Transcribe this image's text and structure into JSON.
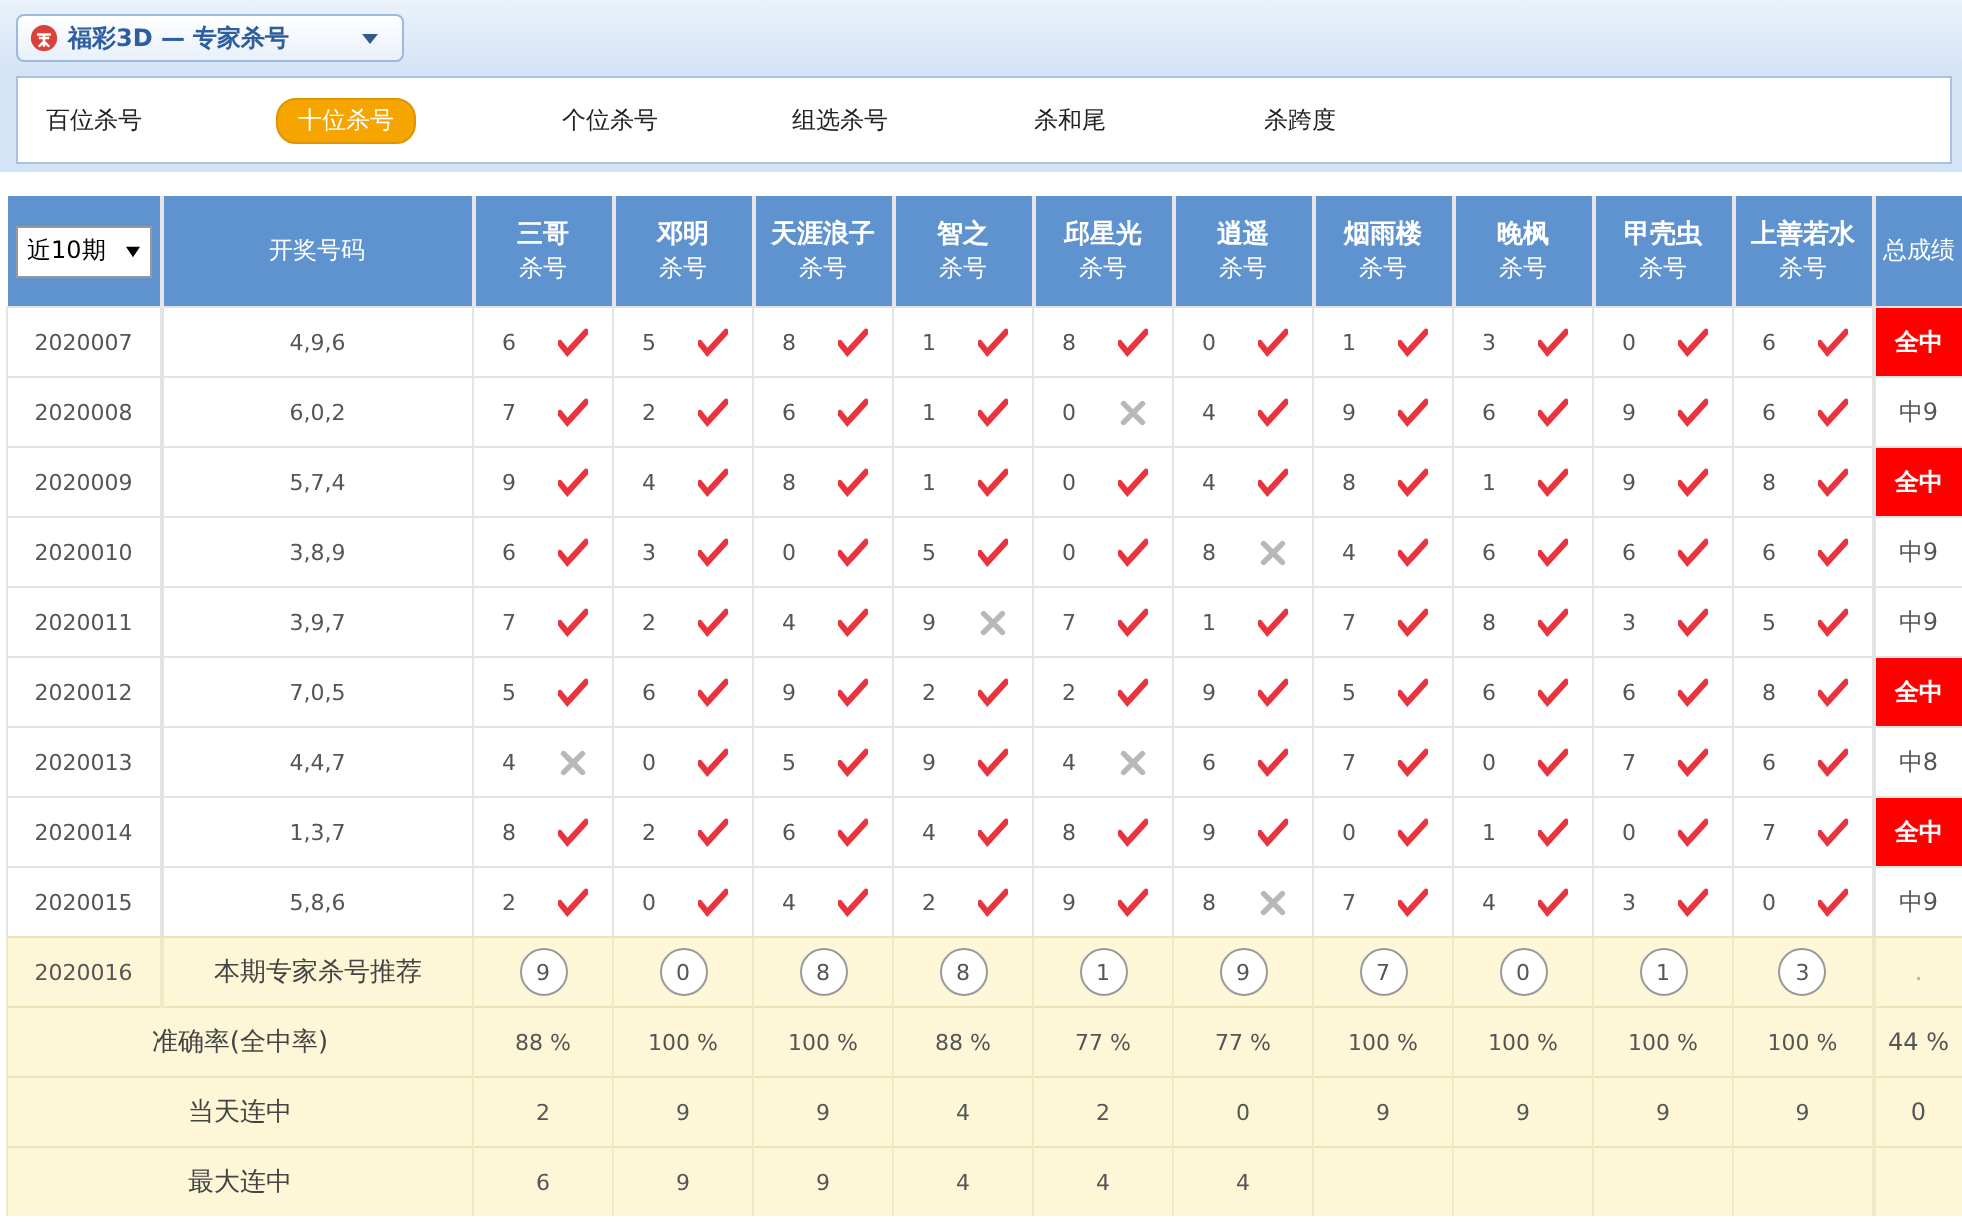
{
  "header": {
    "title": "福彩3D — 专家杀号"
  },
  "tabs": [
    {
      "label": "百位杀号",
      "selected": false
    },
    {
      "label": "十位杀号",
      "selected": true
    },
    {
      "label": "个位杀号",
      "selected": false
    },
    {
      "label": "组选杀号",
      "selected": false
    },
    {
      "label": "杀和尾",
      "selected": false
    },
    {
      "label": "杀跨度",
      "selected": false
    }
  ],
  "table": {
    "period_select": "近10期",
    "draw_column": "开奖号码",
    "total_column": "总成绩",
    "experts": [
      {
        "name": "三哥",
        "sub": "杀号"
      },
      {
        "name": "邓明",
        "sub": "杀号"
      },
      {
        "name": "天涯浪子",
        "sub": "杀号"
      },
      {
        "name": "智之",
        "sub": "杀号"
      },
      {
        "name": "邱星光",
        "sub": "杀号"
      },
      {
        "name": "逍遥",
        "sub": "杀号"
      },
      {
        "name": "烟雨楼",
        "sub": "杀号"
      },
      {
        "name": "晚枫",
        "sub": "杀号"
      },
      {
        "name": "甲壳虫",
        "sub": "杀号"
      },
      {
        "name": "上善若水",
        "sub": "杀号"
      }
    ],
    "rows": [
      {
        "period": "2020007",
        "draw": "4,9,6",
        "total": "全中",
        "highlight": true,
        "picks": [
          {
            "number": "6",
            "hit": true
          },
          {
            "number": "5",
            "hit": true
          },
          {
            "number": "8",
            "hit": true
          },
          {
            "number": "1",
            "hit": true
          },
          {
            "number": "8",
            "hit": true
          },
          {
            "number": "0",
            "hit": true
          },
          {
            "number": "1",
            "hit": true
          },
          {
            "number": "3",
            "hit": true
          },
          {
            "number": "0",
            "hit": true
          },
          {
            "number": "6",
            "hit": true
          }
        ]
      },
      {
        "period": "2020008",
        "draw": "6,0,2",
        "total": "中9",
        "highlight": false,
        "picks": [
          {
            "number": "7",
            "hit": true
          },
          {
            "number": "2",
            "hit": true
          },
          {
            "number": "6",
            "hit": true
          },
          {
            "number": "1",
            "hit": true
          },
          {
            "number": "0",
            "hit": false
          },
          {
            "number": "4",
            "hit": true
          },
          {
            "number": "9",
            "hit": true
          },
          {
            "number": "6",
            "hit": true
          },
          {
            "number": "9",
            "hit": true
          },
          {
            "number": "6",
            "hit": true
          }
        ]
      },
      {
        "period": "2020009",
        "draw": "5,7,4",
        "total": "全中",
        "highlight": true,
        "picks": [
          {
            "number": "9",
            "hit": true
          },
          {
            "number": "4",
            "hit": true
          },
          {
            "number": "8",
            "hit": true
          },
          {
            "number": "1",
            "hit": true
          },
          {
            "number": "0",
            "hit": true
          },
          {
            "number": "4",
            "hit": true
          },
          {
            "number": "8",
            "hit": true
          },
          {
            "number": "1",
            "hit": true
          },
          {
            "number": "9",
            "hit": true
          },
          {
            "number": "8",
            "hit": true
          }
        ]
      },
      {
        "period": "2020010",
        "draw": "3,8,9",
        "total": "中9",
        "highlight": false,
        "picks": [
          {
            "number": "6",
            "hit": true
          },
          {
            "number": "3",
            "hit": true
          },
          {
            "number": "0",
            "hit": true
          },
          {
            "number": "5",
            "hit": true
          },
          {
            "number": "0",
            "hit": true
          },
          {
            "number": "8",
            "hit": false
          },
          {
            "number": "4",
            "hit": true
          },
          {
            "number": "6",
            "hit": true
          },
          {
            "number": "6",
            "hit": true
          },
          {
            "number": "6",
            "hit": true
          }
        ]
      },
      {
        "period": "2020011",
        "draw": "3,9,7",
        "total": "中9",
        "highlight": false,
        "picks": [
          {
            "number": "7",
            "hit": true
          },
          {
            "number": "2",
            "hit": true
          },
          {
            "number": "4",
            "hit": true
          },
          {
            "number": "9",
            "hit": false
          },
          {
            "number": "7",
            "hit": true
          },
          {
            "number": "1",
            "hit": true
          },
          {
            "number": "7",
            "hit": true
          },
          {
            "number": "8",
            "hit": true
          },
          {
            "number": "3",
            "hit": true
          },
          {
            "number": "5",
            "hit": true
          }
        ]
      },
      {
        "period": "2020012",
        "draw": "7,0,5",
        "total": "全中",
        "highlight": true,
        "picks": [
          {
            "number": "5",
            "hit": true
          },
          {
            "number": "6",
            "hit": true
          },
          {
            "number": "9",
            "hit": true
          },
          {
            "number": "2",
            "hit": true
          },
          {
            "number": "2",
            "hit": true
          },
          {
            "number": "9",
            "hit": true
          },
          {
            "number": "5",
            "hit": true
          },
          {
            "number": "6",
            "hit": true
          },
          {
            "number": "6",
            "hit": true
          },
          {
            "number": "8",
            "hit": true
          }
        ]
      },
      {
        "period": "2020013",
        "draw": "4,4,7",
        "total": "中8",
        "highlight": false,
        "picks": [
          {
            "number": "4",
            "hit": false
          },
          {
            "number": "0",
            "hit": true
          },
          {
            "number": "5",
            "hit": true
          },
          {
            "number": "9",
            "hit": true
          },
          {
            "number": "4",
            "hit": false
          },
          {
            "number": "6",
            "hit": true
          },
          {
            "number": "7",
            "hit": true
          },
          {
            "number": "0",
            "hit": true
          },
          {
            "number": "7",
            "hit": true
          },
          {
            "number": "6",
            "hit": true
          }
        ]
      },
      {
        "period": "2020014",
        "draw": "1,3,7",
        "total": "全中",
        "highlight": true,
        "picks": [
          {
            "number": "8",
            "hit": true
          },
          {
            "number": "2",
            "hit": true
          },
          {
            "number": "6",
            "hit": true
          },
          {
            "number": "4",
            "hit": true
          },
          {
            "number": "8",
            "hit": true
          },
          {
            "number": "9",
            "hit": true
          },
          {
            "number": "0",
            "hit": true
          },
          {
            "number": "1",
            "hit": true
          },
          {
            "number": "0",
            "hit": true
          },
          {
            "number": "7",
            "hit": true
          }
        ]
      },
      {
        "period": "2020015",
        "draw": "5,8,6",
        "total": "中9",
        "highlight": false,
        "picks": [
          {
            "number": "2",
            "hit": true
          },
          {
            "number": "0",
            "hit": true
          },
          {
            "number": "4",
            "hit": true
          },
          {
            "number": "2",
            "hit": true
          },
          {
            "number": "9",
            "hit": true
          },
          {
            "number": "8",
            "hit": false
          },
          {
            "number": "7",
            "hit": true
          },
          {
            "number": "4",
            "hit": true
          },
          {
            "number": "3",
            "hit": true
          },
          {
            "number": "0",
            "hit": true
          }
        ]
      }
    ],
    "recommendation": {
      "period": "2020016",
      "label": "本期专家杀号推荐",
      "numbers": [
        "9",
        "0",
        "8",
        "8",
        "1",
        "9",
        "7",
        "0",
        "1",
        "3"
      ],
      "total": "."
    },
    "stats": [
      {
        "label": "准确率(全中率)",
        "values": [
          "88 %",
          "100 %",
          "100 %",
          "88 %",
          "77 %",
          "77 %",
          "100 %",
          "100 %",
          "100 %",
          "100 %"
        ],
        "total": "44 %"
      },
      {
        "label": "当天连中",
        "values": [
          "2",
          "9",
          "9",
          "4",
          "2",
          "0",
          "9",
          "9",
          "9",
          "9"
        ],
        "total": "0"
      },
      {
        "label": "最大连中",
        "values": [
          "6",
          "9",
          "9",
          "4",
          "4",
          "4"
        ]
      }
    ]
  }
}
